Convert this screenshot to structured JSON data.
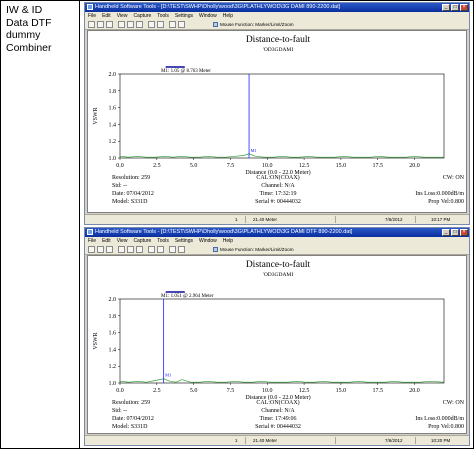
{
  "left_cell": {
    "label": "IW & ID\nData DTF\ndummy\nCombiner"
  },
  "window_controls": {
    "minimize": "_",
    "maximize": "□",
    "close": "×"
  },
  "menu": [
    "File",
    "Edit",
    "View",
    "Capture",
    "Tools",
    "Settings",
    "Window",
    "Help"
  ],
  "toolbar": {
    "mouse_function_label": "Mouse Function: Marker/Limit/Zoom"
  },
  "colors": {
    "trace": "#2e9e2e",
    "marker": "#2020ff",
    "limit": "#0a0a9a",
    "title_bar": "#0a2e9e"
  },
  "windows": [
    {
      "title": "Handheld Software Tools - [D:\\TEST\\SWHP\\Dholly\\wood\\3G\\PLATHLYWOD\\3G DAMI 890-2200.dat]",
      "plot": {
        "title": "Distance-to-fault",
        "subtitle": "'OD3GDAMI",
        "marker_label": "M1: 1.05 @ 8.763 Meter",
        "ylabel": "VSWR",
        "xlabel": "Distance (0.0 - 22.0 Meter)",
        "x_ticks": [
          "0.0",
          "2.5",
          "5.0",
          "7.5",
          "10.0",
          "12.5",
          "15.0",
          "17.5",
          "20.0"
        ],
        "y_ticks": [
          "1.0",
          "1.2",
          "1.4",
          "1.6",
          "1.8",
          "2.0"
        ],
        "left_info": [
          "Resolution: 259",
          "Std: --",
          "Date: 07/04/2012",
          "Model: S331D"
        ],
        "center_info": [
          "CAL:ON(COAX)",
          "Channel: N/A",
          "Time: 17:32:19",
          "Serial #: 00444032"
        ],
        "right_info": [
          "CW: ON",
          "",
          "Ins Loss:0.000dB/m",
          "Prop Vel:0.800"
        ]
      },
      "status": {
        "col1": "1",
        "col2": "21.40 Meter",
        "date": "7/6/2012",
        "time": "10:17 PM"
      }
    },
    {
      "title": "Handheld Software Tools - [D:\\TEST\\SWHP\\Dholly\\wood\\3G\\PLATHLYWOD\\3G DAMI DTF 890-2200.dat]",
      "plot": {
        "title": "Distance-to-fault",
        "subtitle": "'OD3GDAMI",
        "marker_label": "M1: 1.051 @ 2.964 Meter",
        "ylabel": "VSWR",
        "xlabel": "Distance (0.0 - 22.0 Meter)",
        "x_ticks": [
          "0.0",
          "2.5",
          "5.0",
          "7.5",
          "10.0",
          "12.5",
          "15.0",
          "17.5",
          "20.0"
        ],
        "y_ticks": [
          "1.0",
          "1.2",
          "1.4",
          "1.6",
          "1.8",
          "2.0"
        ],
        "left_info": [
          "Resolution: 259",
          "Std: --",
          "Date: 07/04/2012",
          "Model: S331D"
        ],
        "center_info": [
          "CAL:ON(COAX)",
          "Channel: N/A",
          "Time: 17:49:06",
          "Serial #: 00444032"
        ],
        "right_info": [
          "CW: ON",
          "",
          "Ins Loss:0.000dB/m",
          "Prop Vel:0.800"
        ]
      },
      "status": {
        "col1": "1",
        "col2": "21.40 Meter",
        "date": "7/6/2012",
        "time": "10:20 PM"
      }
    }
  ],
  "chart_data": [
    {
      "type": "line",
      "title": "Distance-to-fault",
      "subtitle": "'OD3GDAMI",
      "xlabel": "Distance (0.0 - 22.0 Meter)",
      "ylabel": "VSWR",
      "xlim": [
        0,
        22
      ],
      "ylim": [
        1.0,
        2.0
      ],
      "grid": false,
      "x_ticks": [
        0,
        2.5,
        5,
        7.5,
        10,
        12.5,
        15,
        17.5,
        20
      ],
      "y_ticks": [
        1.0,
        1.2,
        1.4,
        1.6,
        1.8,
        2.0
      ],
      "series": [
        {
          "x": [
            0,
            0.6,
            1.2,
            1.8,
            2.4,
            3.0,
            3.6,
            4.2,
            4.8,
            5.4,
            6.0,
            6.6,
            7.2,
            7.8,
            8.4,
            8.76,
            9.2,
            9.8,
            10.4,
            11.0,
            11.6,
            12.2,
            12.8,
            13.4,
            14.0,
            14.6,
            15.2,
            15.8,
            16.4,
            17.0,
            17.6,
            18.2,
            18.8,
            19.4,
            20.0,
            20.6,
            21.2,
            22.0
          ],
          "y": [
            1.02,
            1.01,
            1.02,
            1.01,
            1.01,
            1.02,
            1.01,
            1.02,
            1.01,
            1.01,
            1.02,
            1.01,
            1.01,
            1.02,
            1.03,
            1.05,
            1.02,
            1.01,
            1.01,
            1.02,
            1.01,
            1.01,
            1.02,
            1.01,
            1.01,
            1.01,
            1.02,
            1.01,
            1.01,
            1.01,
            1.02,
            1.01,
            1.01,
            1.01,
            1.02,
            1.01,
            1.01,
            1.01
          ]
        }
      ],
      "markers": [
        {
          "name": "M1",
          "x": 8.763,
          "y": 1.05
        }
      ],
      "limit_line": {
        "x_start": 3.1,
        "x_end": 4.4,
        "y": 2.0
      }
    },
    {
      "type": "line",
      "title": "Distance-to-fault",
      "subtitle": "'OD3GDAMI",
      "xlabel": "Distance (0.0 - 22.0 Meter)",
      "ylabel": "VSWR",
      "xlim": [
        0,
        22
      ],
      "ylim": [
        1.0,
        2.0
      ],
      "grid": false,
      "x_ticks": [
        0,
        2.5,
        5,
        7.5,
        10,
        12.5,
        15,
        17.5,
        20
      ],
      "y_ticks": [
        1.0,
        1.2,
        1.4,
        1.6,
        1.8,
        2.0
      ],
      "series": [
        {
          "x": [
            0,
            0.6,
            1.2,
            1.8,
            2.4,
            2.96,
            3.4,
            3.8,
            4.2,
            4.8,
            5.4,
            6.0,
            6.6,
            7.2,
            7.8,
            8.4,
            9.0,
            9.6,
            10.2,
            10.8,
            11.4,
            12.0,
            12.6,
            13.2,
            13.8,
            14.4,
            15.0,
            15.6,
            16.2,
            16.8,
            17.4,
            18.0,
            18.6,
            19.2,
            19.8,
            20.4,
            21.0,
            22.0
          ],
          "y": [
            1.02,
            1.01,
            1.02,
            1.01,
            1.03,
            1.05,
            1.02,
            1.01,
            1.04,
            1.01,
            1.01,
            1.02,
            1.01,
            1.01,
            1.02,
            1.01,
            1.01,
            1.02,
            1.01,
            1.01,
            1.01,
            1.02,
            1.01,
            1.01,
            1.02,
            1.01,
            1.01,
            1.01,
            1.02,
            1.01,
            1.01,
            1.01,
            1.02,
            1.01,
            1.01,
            1.01,
            1.02,
            1.01
          ]
        }
      ],
      "markers": [
        {
          "name": "M1",
          "x": 2.964,
          "y": 1.051
        }
      ],
      "limit_line": {
        "x_start": 3.1,
        "x_end": 4.4,
        "y": 2.0
      }
    }
  ]
}
